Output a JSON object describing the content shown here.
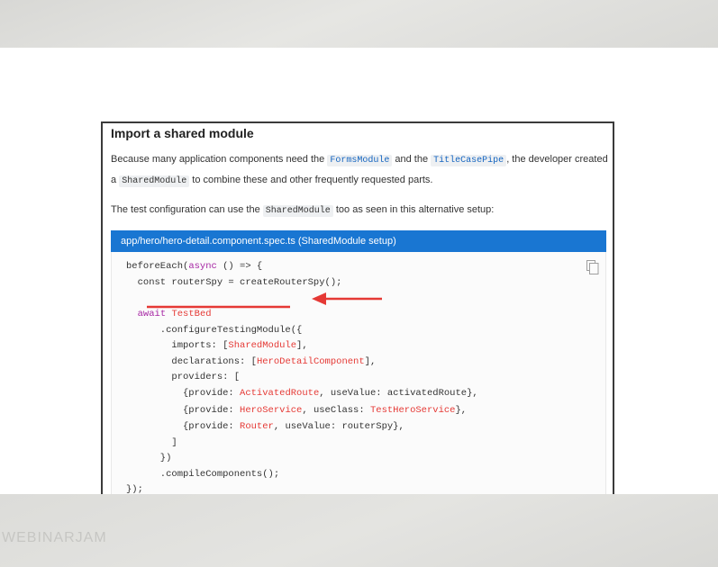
{
  "doc": {
    "heading": "Import a shared module",
    "para1": {
      "t1": "Because many application components need the ",
      "c1": "FormsModule",
      "t2": " and the ",
      "c2": "TitleCasePipe",
      "t3": ", the developer created"
    },
    "para2": {
      "t1": "a ",
      "c1": "SharedModule",
      "t2": " to combine these and other frequently requested parts."
    },
    "para3": {
      "t1": "The test configuration can use the ",
      "c1": "SharedModule",
      "t2": " too as seen in this alternative setup:"
    },
    "code_header": "app/hero/hero-detail.component.spec.ts (SharedModule setup)",
    "copy_icon": "copy-icon",
    "code": {
      "l1a": "beforeEach(",
      "l1b": "async",
      "l1c": " () => {",
      "l2": "  const routerSpy = createRouterSpy();",
      "l3a": "  ",
      "l3b": "await",
      "l3c": " ",
      "l3d": "TestBed",
      "l4": "      .configureTestingModule({",
      "l5a": "        imports: [",
      "l5b": "SharedModule",
      "l5c": "],",
      "l6a": "        declarations: [",
      "l6b": "HeroDetailComponent",
      "l6c": "],",
      "l7": "        providers: [",
      "l8a": "          {provide: ",
      "l8b": "ActivatedRoute",
      "l8c": ", useValue: activatedRoute},",
      "l9a": "          {provide: ",
      "l9b": "HeroService",
      "l9c": ", useClass: ",
      "l9d": "TestHeroService",
      "l9e": "},",
      "l10a": "          {provide: ",
      "l10b": "Router",
      "l10c": ", useValue: routerSpy},",
      "l11": "        ]",
      "l12": "      })",
      "l13": "      .compileComponents();",
      "l14": "});"
    }
  },
  "annotation": {
    "color": "#e53935"
  },
  "watermark": "WEBINARJAM"
}
